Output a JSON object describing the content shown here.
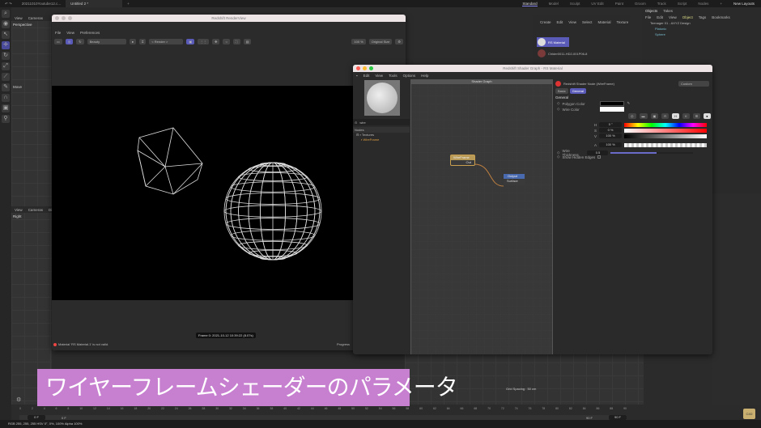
{
  "topbar": {
    "tabs": [
      "20211010Youtube12.c...",
      "Untitled 2 *"
    ],
    "add": "+",
    "layouts": [
      "Standard",
      "Model",
      "Sculpt",
      "UV Edit",
      "Paint",
      "Groom",
      "Track",
      "Script",
      "Nodes"
    ],
    "layouts_add": "+",
    "new_layouts": "New Layouts"
  },
  "viewport": {
    "menu": [
      "View",
      "Cameras"
    ],
    "name": "Perspective",
    "lower_menu": [
      "View",
      "Cameras",
      "Disp"
    ],
    "lower_name": "Right",
    "move_label": "Move",
    "grid_spacing": "Grid Spacing : 50 cm"
  },
  "renderview": {
    "title": "Redshift RenderView",
    "menu": [
      "File",
      "View",
      "Preferences"
    ],
    "aov": "Beauty",
    "render_select": "< Render >",
    "zoom": "100 %",
    "size": "Original Size",
    "frame_info": "Frame 0:  2021-10-12  10:39:22  (8.07s)",
    "error": "Material 'RS Material.1' is not valid.",
    "progress": "Progress"
  },
  "materials": {
    "menu": [
      "Create",
      "Edit",
      "View",
      "Select",
      "Material",
      "Texture"
    ],
    "items": [
      "RS Material",
      "Chlder0011-HD2-001P06-8"
    ]
  },
  "objects": {
    "tabs": [
      "Objects",
      "Takes"
    ],
    "menu": [
      "File",
      "Edit",
      "View",
      "Object",
      "Tags",
      "Bookmarks"
    ],
    "items": [
      "Teenager 01 - AXYZ Design",
      "Platonic",
      "Sphere"
    ]
  },
  "shader": {
    "title": "Redshift Shader Graph - RS Material",
    "menu": [
      "Edit",
      "View",
      "Tools",
      "Options",
      "Help"
    ],
    "search": "wire",
    "nodes_header": "Nodes",
    "tree": [
      "Textures",
      "WireFrame"
    ],
    "graph_title": "Shader Graph",
    "node_wire": {
      "title": "WireFrame",
      "out": "Out"
    },
    "node_output": {
      "title": "Output",
      "in": "Surface"
    },
    "attr": {
      "header": "Redshift Shader Node (WireFrame)",
      "mode": "Custom",
      "tabs": [
        "Basic",
        "General"
      ],
      "section": "General",
      "polygon_color": "Polygon Color",
      "wire_color": "Wire Color",
      "h_label": "H",
      "h": "0 °",
      "s_label": "S",
      "s": "0 %",
      "v_label": "V",
      "v": "100 %",
      "a_label": "A",
      "a": "100 %",
      "wire_thickness": "Wire Thickness",
      "thickness": "0.5",
      "thickness_fraction": 0.55,
      "hidden_edges": "Show Hidden Edges"
    }
  },
  "caption": "ワイヤーフレームシェーダーのパラメータ",
  "timeline": {
    "ticks": [
      0,
      2,
      4,
      6,
      8,
      10,
      12,
      14,
      16,
      18,
      20,
      22,
      24,
      26,
      28,
      30,
      32,
      34,
      36,
      38,
      40,
      42,
      44,
      46,
      48,
      50,
      52,
      54,
      56,
      58,
      60,
      62,
      64,
      66,
      68,
      70,
      72,
      74,
      76,
      78,
      80,
      82,
      84,
      86,
      88,
      90
    ],
    "start": "0 F",
    "start2": "0 F",
    "end": "90 F",
    "end2": "90 F"
  },
  "status": "RGB 255, 255, 255   HSV 0°, 0%, 100%   Alpha 100%",
  "colors": {
    "accent": "#5a5ab8",
    "caption_bg": "#c77fcf"
  }
}
